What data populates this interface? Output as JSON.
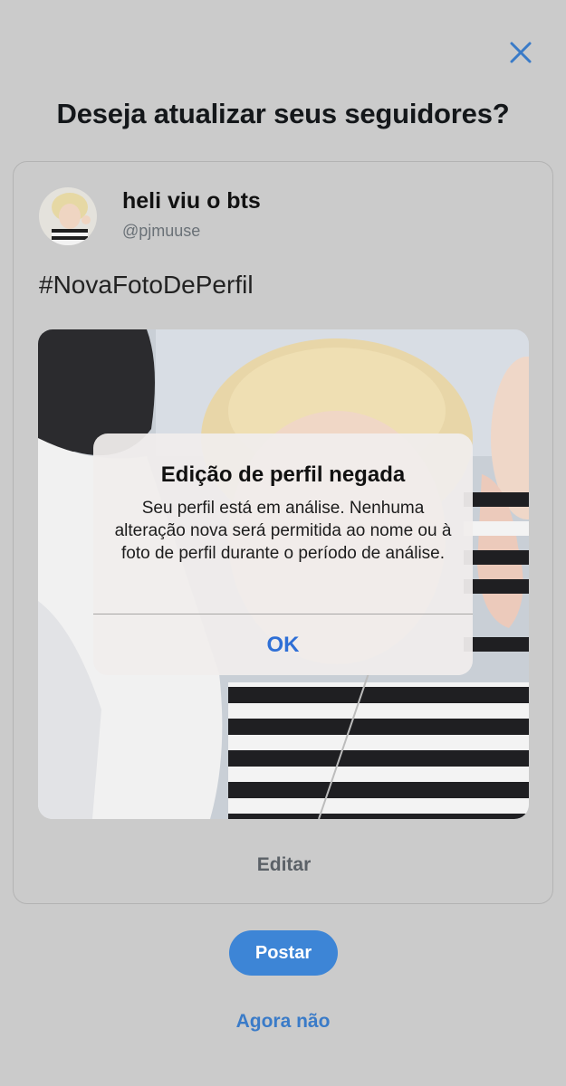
{
  "dialog": {
    "title": "Deseja atualizar seus seguidores?"
  },
  "tweet_preview": {
    "display_name": "heli viu o bts",
    "handle": "@pjmuuse",
    "text": "#NovaFotoDePerfil",
    "edit_label": "Editar"
  },
  "alert": {
    "title": "Edição de perfil negada",
    "message": "Seu perfil está em análise. Nenhuma alteração nova será permitida ao nome ou à foto de perfil durante o período de análise.",
    "ok_label": "OK"
  },
  "actions": {
    "post_label": "Postar",
    "not_now_label": "Agora não"
  },
  "icons": {
    "close": "close-icon"
  },
  "colors": {
    "accent": "#3d85d6",
    "background": "#cbcbcb"
  }
}
